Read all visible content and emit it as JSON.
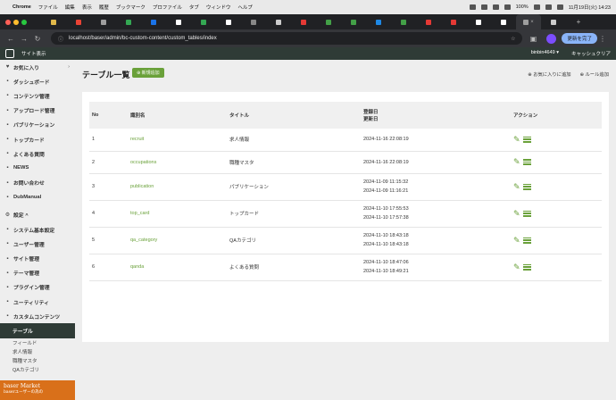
{
  "menubar": {
    "app": "Chrome",
    "items": [
      "ファイル",
      "編集",
      "表示",
      "履歴",
      "ブックマーク",
      "プロファイル",
      "タブ",
      "ウィンドウ",
      "ヘルプ"
    ],
    "battery": "100%",
    "clock": "11月19日(火) 14:23"
  },
  "browser": {
    "url": "localhost/baser/admin/bc-custom-content/custom_tables/index",
    "update_label": "更新を完了"
  },
  "topbar": {
    "site_label": "サイト表示",
    "user_label": "binbin4649 ▾",
    "cache_label": "キャッシュクリア"
  },
  "sidebar": {
    "items": [
      {
        "icon": "♥",
        "label": "お気に入り"
      },
      {
        "icon": "▪",
        "label": "ダッシュボード"
      },
      {
        "icon": "▪",
        "label": "コンテンツ管理"
      },
      {
        "icon": "▪",
        "label": "アップロード管理"
      },
      {
        "icon": "▪",
        "label": "パブリケーション"
      },
      {
        "icon": "▪",
        "label": "トップカード"
      },
      {
        "icon": "▪",
        "label": "よくある質問"
      },
      {
        "icon": "▪",
        "label": "NEWS"
      },
      {
        "icon": "▪",
        "label": "お問い合わせ"
      },
      {
        "icon": "▪",
        "label": "DubManual"
      },
      {
        "icon": "⚙",
        "label": "設定 ^"
      },
      {
        "icon": "▪",
        "label": "システム基本設定"
      },
      {
        "icon": "▪",
        "label": "ユーザー管理"
      },
      {
        "icon": "▪",
        "label": "サイト管理"
      },
      {
        "icon": "▪",
        "label": "テーマ管理"
      },
      {
        "icon": "▪",
        "label": "プラグイン管理"
      },
      {
        "icon": "▪",
        "label": "ユーティリティ"
      },
      {
        "icon": "▪",
        "label": "カスタムコンテンツ"
      }
    ],
    "active_label": "テーブル",
    "subitems": [
      "フィールド",
      "求人情報",
      "職種マスタ",
      "QAカテゴリ"
    ],
    "banner_line1": "baser Market",
    "banner_line2": "baserユーザーの為の"
  },
  "main": {
    "title": "テーブル一覧",
    "new_button": "新規追加",
    "fav_link": "お気に入りに追加",
    "rule_link": "ルール追加",
    "columns": {
      "no": "No",
      "identifier": "識別名",
      "title": "タイトル",
      "created": "登録日",
      "modified": "更新日",
      "action": "アクション"
    },
    "rows": [
      {
        "no": "1",
        "name": "recruit",
        "title": "求人情報",
        "created": "2024-11-16 22:08:19",
        "modified": ""
      },
      {
        "no": "2",
        "name": "occupations",
        "title": "職種マスタ",
        "created": "2024-11-16 22:08:19",
        "modified": ""
      },
      {
        "no": "3",
        "name": "publication",
        "title": "パブリケーション",
        "created": "2024-11-09 11:15:32",
        "modified": "2024-11-09 11:16:21"
      },
      {
        "no": "4",
        "name": "top_card",
        "title": "トップカード",
        "created": "2024-11-10 17:55:53",
        "modified": "2024-11-10 17:57:38"
      },
      {
        "no": "5",
        "name": "qa_category",
        "title": "QAカテゴリ",
        "created": "2024-11-10 18:43:18",
        "modified": "2024-11-10 18:43:18"
      },
      {
        "no": "6",
        "name": "qanda",
        "title": "よくある質問",
        "created": "2024-11-10 18:47:06",
        "modified": "2024-11-10 18:49:21"
      }
    ]
  },
  "colors": {
    "accent": "#6aa13a",
    "topbar": "#2f3b36",
    "chrome_dark": "#202124"
  }
}
